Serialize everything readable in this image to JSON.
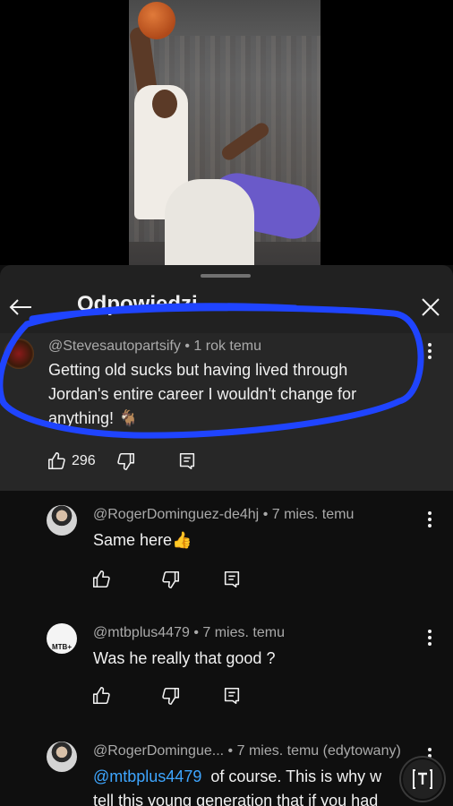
{
  "panel": {
    "title": "Odpowiedzi"
  },
  "parent_comment": {
    "author": "@Stevesautopartsify",
    "time": "1 rok temu",
    "text_lines": [
      "Getting old sucks but having lived through",
      "Jordan's entire career I wouldn't change for",
      "anything! 🐐"
    ],
    "likes": "296"
  },
  "replies": [
    {
      "author": "@RogerDominguez-de4hj",
      "time": "7 mies. temu",
      "text": "Same here👍"
    },
    {
      "author": "@mtbplus4479",
      "time": "7 mies. temu",
      "text": "Was he really that good ?",
      "avatar_text": "MTB+"
    },
    {
      "author": "@RogerDomingue...",
      "time": "7 mies. temu (edytowany)",
      "mention": "@mtbplus4479",
      "text_after_mention": "of course. This is why w",
      "text_line2": "tell this young generation that if you had"
    }
  ],
  "separator": "•",
  "icons": {
    "back": "arrow-left-icon",
    "close": "close-icon",
    "more": "more-vert-icon",
    "like": "thumb-up-icon",
    "dislike": "thumb-down-icon",
    "reply": "comment-reply-icon",
    "translate": "translate-icon"
  },
  "colors": {
    "highlight_stroke": "#1f44ff",
    "mention": "#3ea6ff",
    "panel_bg": "#212121"
  }
}
